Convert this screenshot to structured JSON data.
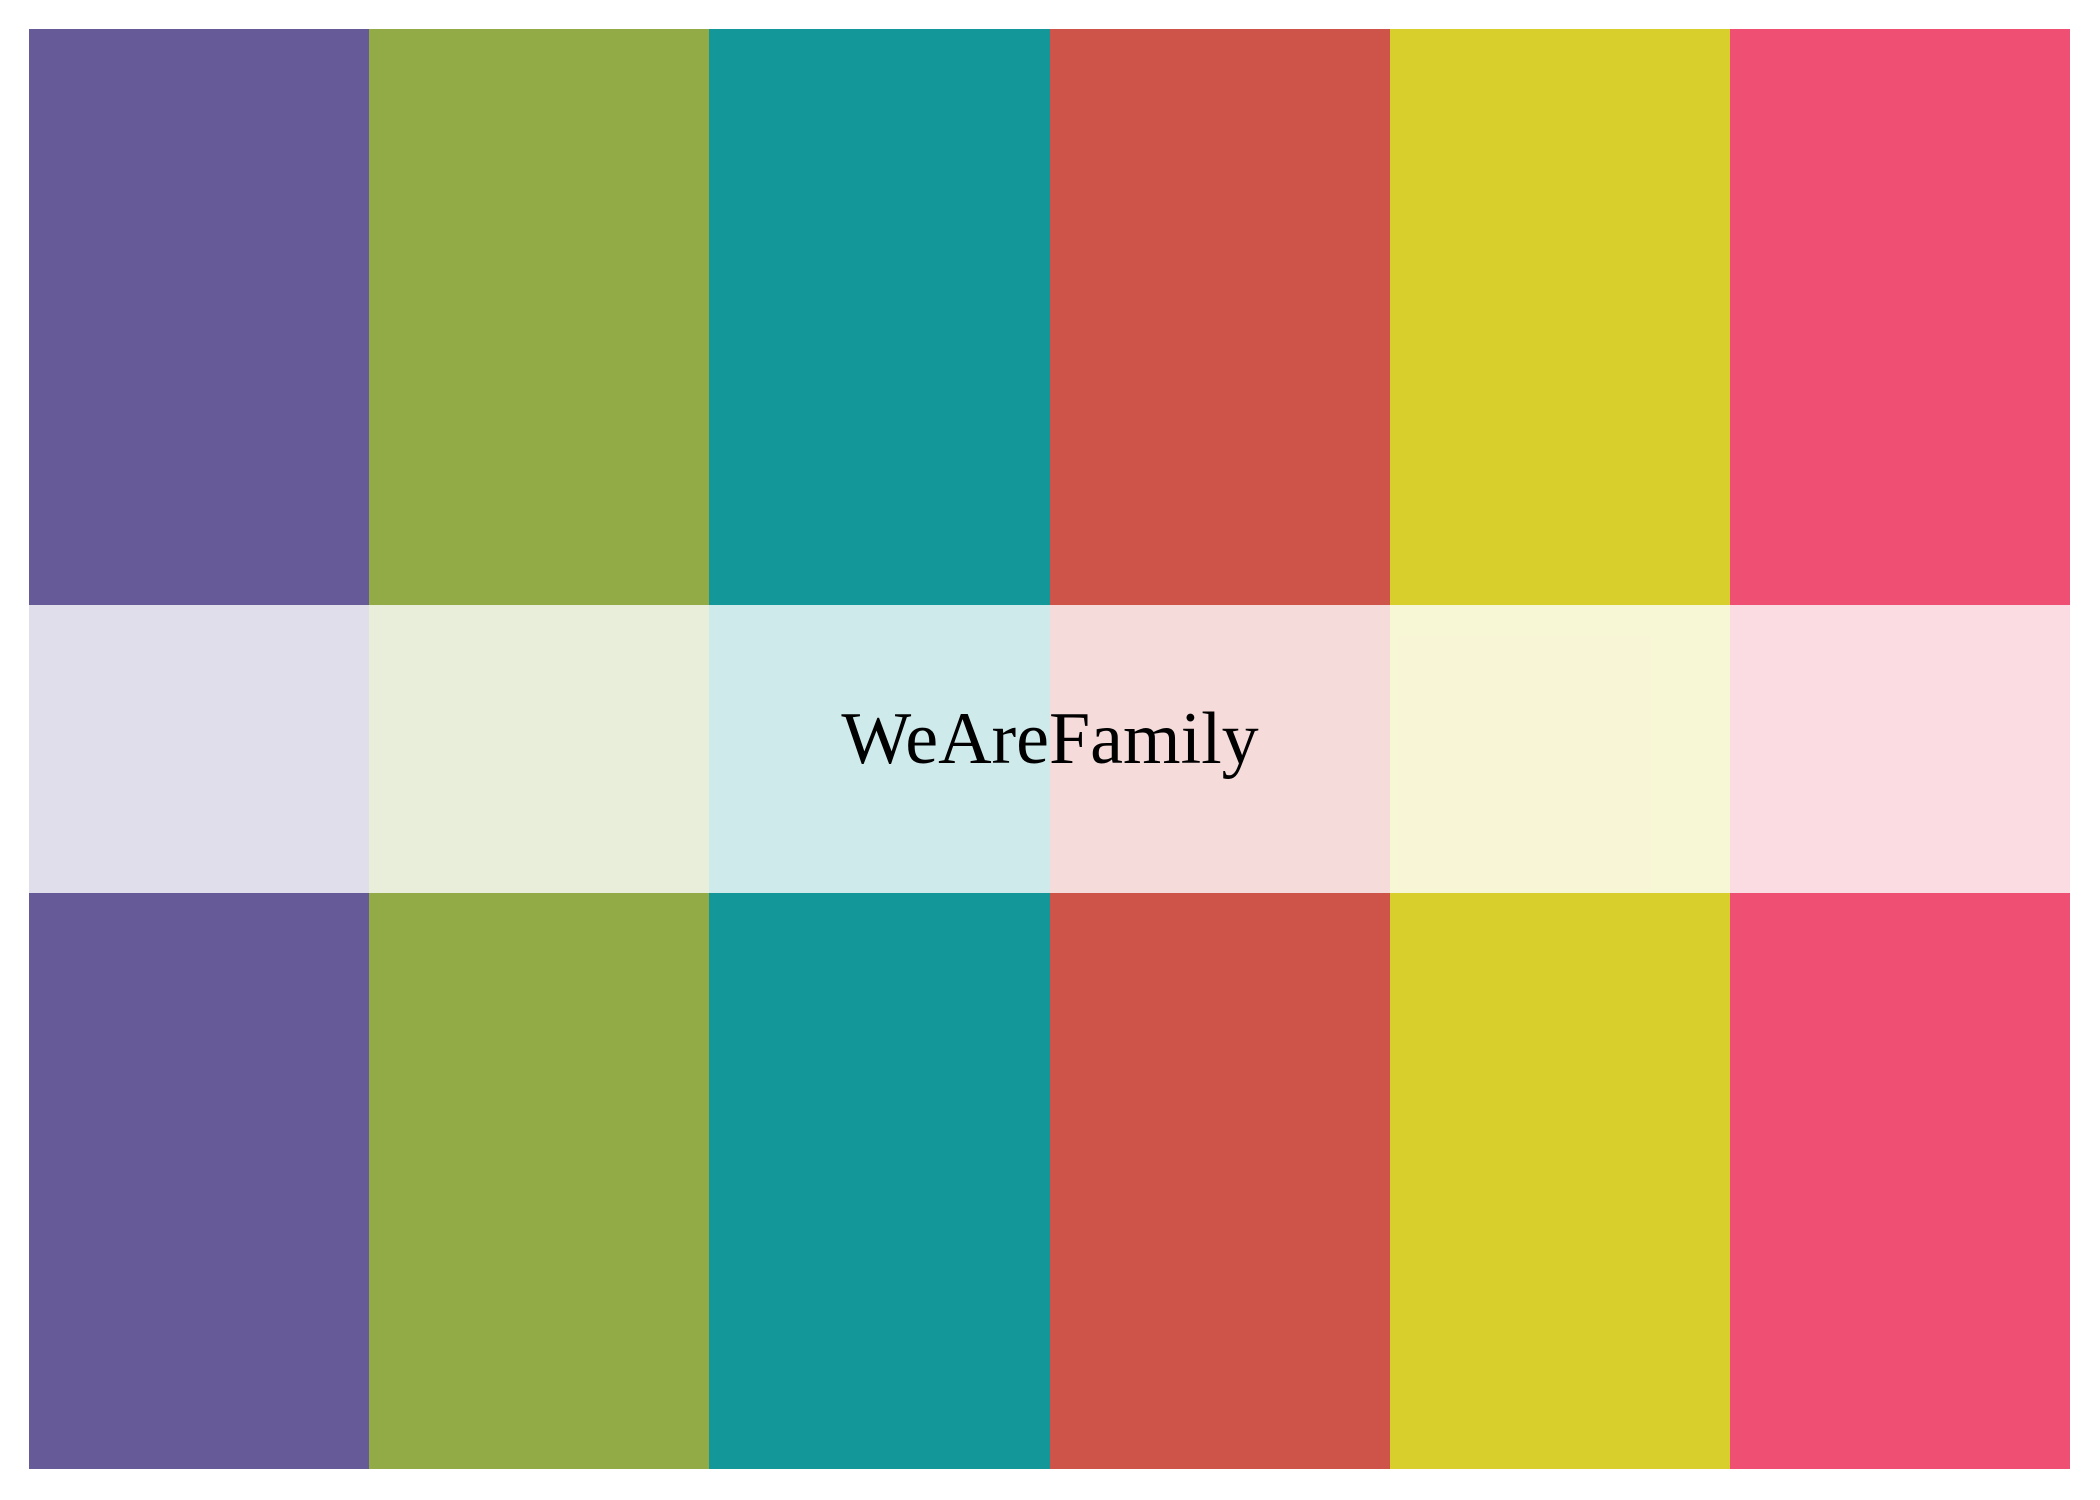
{
  "palette": {
    "name": "WeAreFamily",
    "colors": [
      "#665B98",
      "#93AB47",
      "#139799",
      "#CE5348",
      "#D8CF2D",
      "#EE4F73"
    ]
  }
}
